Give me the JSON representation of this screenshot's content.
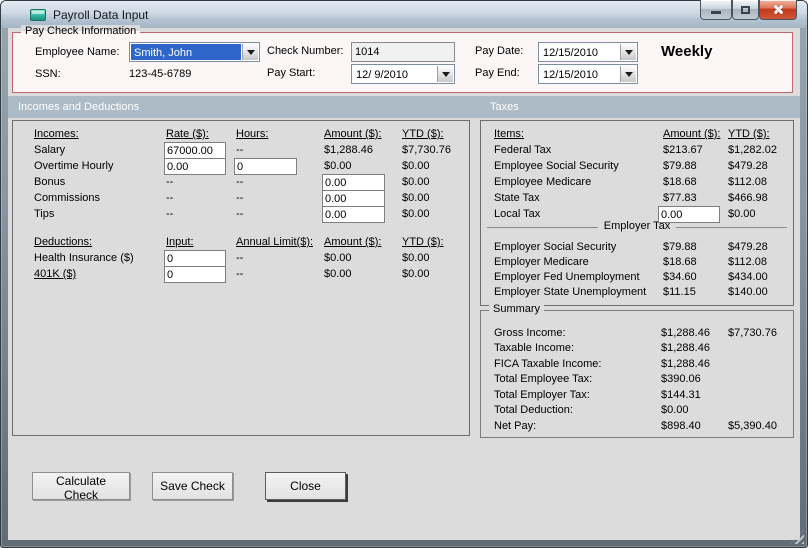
{
  "colors": {
    "titlebar": "#ccd8e4",
    "frame": "#6c7882",
    "client_bg": "#dcdcdc",
    "groupbox_border": "#c0686c",
    "groupbox_bg": "#fcf6f6",
    "section_bar": "#acbbc6",
    "selection_blue": "#2e66c9",
    "close_button_red": "#c23a1e"
  },
  "window": {
    "title": "Payroll Data Input",
    "controls": [
      "minimize",
      "maximize",
      "close"
    ]
  },
  "paycheck": {
    "legend": "Pay Check Information",
    "employee_name_label": "Employee Name:",
    "employee_name_value": "Smith, John",
    "ssn_label": "SSN:",
    "ssn_value": "123-45-6789",
    "check_number_label": "Check Number:",
    "check_number_value": "1014",
    "pay_start_label": "Pay Start:",
    "pay_start_value": "12/ 9/2010",
    "pay_date_label": "Pay Date:",
    "pay_date_value": "12/15/2010",
    "pay_end_label": "Pay End:",
    "pay_end_value": "12/15/2010",
    "frequency": "Weekly"
  },
  "section_headers": {
    "left": "Incomes and Deductions",
    "right": "Taxes"
  },
  "incomes": {
    "headers": [
      "Incomes:",
      "Rate ($):",
      "Hours:",
      "Amount ($):",
      "YTD ($):"
    ],
    "rows": [
      {
        "label": "Salary",
        "rate": {
          "v": "67000.00",
          "input": true
        },
        "hours": {
          "v": "--"
        },
        "amount": {
          "v": "$1,288.46"
        },
        "ytd": {
          "v": "$7,730.76"
        }
      },
      {
        "label": "Overtime Hourly",
        "rate": {
          "v": "0.00",
          "input": true
        },
        "hours": {
          "v": "0",
          "input": true
        },
        "amount": {
          "v": "$0.00"
        },
        "ytd": {
          "v": "$0.00"
        }
      },
      {
        "label": "Bonus",
        "rate": {
          "v": "--"
        },
        "hours": {
          "v": "--"
        },
        "amount": {
          "v": "0.00",
          "input": true
        },
        "ytd": {
          "v": "$0.00"
        }
      },
      {
        "label": "Commissions",
        "rate": {
          "v": "--"
        },
        "hours": {
          "v": "--"
        },
        "amount": {
          "v": "0.00",
          "input": true
        },
        "ytd": {
          "v": "$0.00"
        }
      },
      {
        "label": "Tips",
        "rate": {
          "v": "--"
        },
        "hours": {
          "v": "--"
        },
        "amount": {
          "v": "0.00",
          "input": true
        },
        "ytd": {
          "v": "$0.00"
        }
      }
    ]
  },
  "deductions": {
    "headers": [
      "Deductions:",
      "Input:",
      "Annual Limit($):",
      "Amount ($):",
      "YTD ($):"
    ],
    "rows": [
      {
        "label": "Health Insurance  ($)",
        "underline": false,
        "input": {
          "v": "0",
          "input": true
        },
        "limit": {
          "v": "--"
        },
        "amount": {
          "v": "$0.00"
        },
        "ytd": {
          "v": "$0.00"
        }
      },
      {
        "label": "401K  ($)",
        "underline": true,
        "input": {
          "v": "0",
          "input": true
        },
        "limit": {
          "v": "--"
        },
        "amount": {
          "v": "$0.00"
        },
        "ytd": {
          "v": "$0.00"
        }
      }
    ]
  },
  "taxes": {
    "headers": [
      "Items:",
      "Amount ($):",
      "YTD ($):"
    ],
    "rows": [
      {
        "label": "Federal Tax",
        "amount": {
          "v": "$213.67"
        },
        "ytd": {
          "v": "$1,282.02"
        }
      },
      {
        "label": "Employee Social Security",
        "amount": {
          "v": "$79.88"
        },
        "ytd": {
          "v": "$479.28"
        }
      },
      {
        "label": "Employee Medicare",
        "amount": {
          "v": "$18.68"
        },
        "ytd": {
          "v": "$112.08"
        }
      },
      {
        "label": "State Tax",
        "amount": {
          "v": "$77.83"
        },
        "ytd": {
          "v": "$466.98"
        }
      },
      {
        "label": "Local Tax",
        "amount": {
          "v": "0.00",
          "input": true
        },
        "ytd": {
          "v": "$0.00"
        }
      }
    ]
  },
  "employer": {
    "caption": "Employer Tax",
    "rows": [
      {
        "label": "Employer Social Security",
        "amount": "$79.88",
        "ytd": "$479.28"
      },
      {
        "label": "Employer Medicare",
        "amount": "$18.68",
        "ytd": "$112.08"
      },
      {
        "label": "Employer Fed Unemployment",
        "amount": "$34.60",
        "ytd": "$434.00"
      },
      {
        "label": "Employer State Unemployment",
        "amount": "$11.15",
        "ytd": "$140.00"
      }
    ]
  },
  "summary": {
    "legend": "Summary",
    "rows": [
      {
        "label": "Gross Income:",
        "amount": "$1,288.46",
        "ytd": "$7,730.76"
      },
      {
        "label": "Taxable Income:",
        "amount": "$1,288.46",
        "ytd": ""
      },
      {
        "label": "FICA Taxable Income:",
        "amount": "$1,288.46",
        "ytd": ""
      },
      {
        "label": "Total Employee Tax:",
        "amount": "$390.06",
        "ytd": ""
      },
      {
        "label": "Total Employer Tax:",
        "amount": "$144.31",
        "ytd": ""
      },
      {
        "label": "Total Deduction:",
        "amount": "$0.00",
        "ytd": ""
      },
      {
        "label": "Net Pay:",
        "amount": "$898.40",
        "ytd": "$5,390.40"
      }
    ]
  },
  "buttons": {
    "calculate": "Calculate Check",
    "save": "Save Check",
    "close": "Close"
  }
}
